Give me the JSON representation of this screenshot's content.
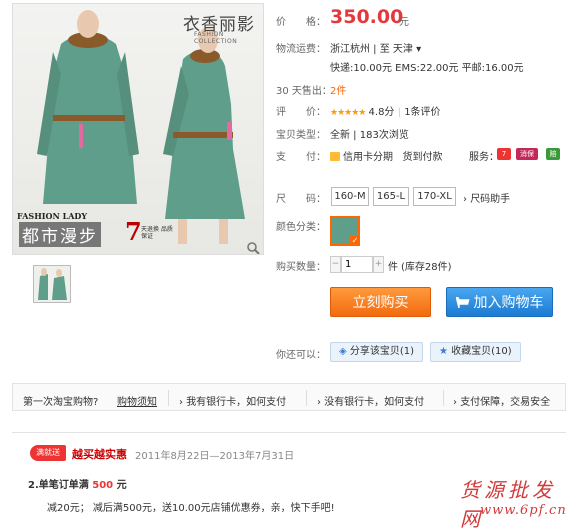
{
  "gallery": {
    "brand_logo": "衣香丽影",
    "brand_sub": "FASHION COLLECTION",
    "fashion_lady": "FASHION LADY",
    "slogan": "都市漫步",
    "slogan_seven": "7",
    "slogan_small": "天退换 品质保证"
  },
  "price": {
    "label": "价　　格：",
    "value": "350.00",
    "unit": "元"
  },
  "logistics": {
    "label": "物流运费：",
    "route": "浙江杭州 | 至  天津 ▾",
    "fees": "快递:10.00元    EMS:22.00元    平邮:16.00元"
  },
  "sales": {
    "label": "30 天售出：",
    "count": "2件"
  },
  "rating": {
    "label": "评　　价：",
    "stars": "★★★★★",
    "score": "4.8分",
    "reviews": "1条评价"
  },
  "item_type": {
    "label": "宝贝类型：",
    "value": "全新  |  183次浏览"
  },
  "payment": {
    "label": "支　　付：",
    "credit": "信用卡分期",
    "cod": "货到付款",
    "service_label": "服务：",
    "badges": [
      "7",
      "消保",
      "赔"
    ],
    "badge_colors": [
      "#e33",
      "#c4285a",
      "#3a9a3a"
    ]
  },
  "size": {
    "label": "尺　　码：",
    "options": [
      "160-M",
      "165-L",
      "170-XL"
    ],
    "helper": "尺码助手"
  },
  "color": {
    "label": "颜色分类：",
    "check": "✓"
  },
  "quantity": {
    "label": "购买数量：",
    "value": "1",
    "unit": "件",
    "stock": "(库存28件)"
  },
  "actions": {
    "buy_now": "立刻购买",
    "add_cart": "加入购物车"
  },
  "share": {
    "label": "你还可以：",
    "share_btn": "分享该宝贝(1)",
    "fav_btn": "收藏宝贝(10)"
  },
  "help": {
    "first_time": "第一次淘宝购物?",
    "guide": "购物须知",
    "items": [
      "我有银行卡，如何支付",
      "没有银行卡，如何支付",
      "支付保障，交易安全"
    ]
  },
  "promotion": {
    "badge": "满就送",
    "title": "越买越实惠",
    "period": "2011年8月22日—2013年7月31日",
    "rule_prefix": "2.单笔订单满",
    "rule_amount": "500",
    "rule_suffix": "元",
    "detail": "减20元；   减后满500元，送10.00元店铺优惠券，亲，快下手吧!"
  },
  "watermark": {
    "cn": "货源批发网",
    "url": "www.6pf.cn"
  },
  "colors": {
    "accent_orange": "#f60",
    "price_red": "#e4393c",
    "cart_blue": "#1c7bd3",
    "dress_green": "#5f9e8b"
  }
}
